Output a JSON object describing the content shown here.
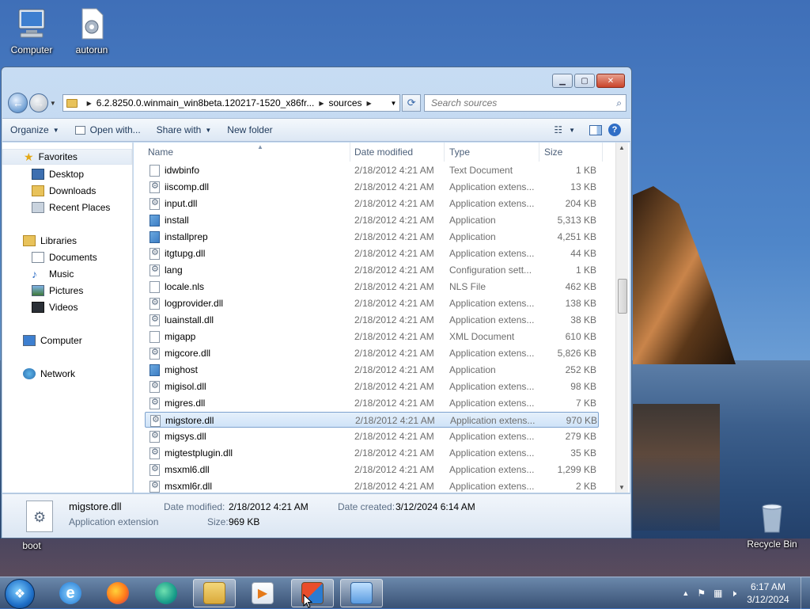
{
  "desktop": {
    "icons": [
      {
        "label": "Computer"
      },
      {
        "label": "autorun"
      },
      {
        "label": "boot"
      },
      {
        "label": "Recycle Bin"
      }
    ]
  },
  "window": {
    "address_segments": [
      "6.2.8250.0.winmain_win8beta.120217-1520_x86fr...",
      "sources"
    ],
    "search_placeholder": "Search sources",
    "toolbar": {
      "organize": "Organize",
      "open_with": "Open with...",
      "share_with": "Share with",
      "new_folder": "New folder"
    },
    "nav_pane": {
      "favorites": "Favorites",
      "desktop": "Desktop",
      "downloads": "Downloads",
      "recent_places": "Recent Places",
      "libraries": "Libraries",
      "documents": "Documents",
      "music": "Music",
      "pictures": "Pictures",
      "videos": "Videos",
      "computer": "Computer",
      "network": "Network"
    },
    "columns": {
      "name": "Name",
      "date": "Date modified",
      "type": "Type",
      "size": "Size"
    },
    "files": [
      {
        "name": "idwbinfo",
        "date": "2/18/2012 4:21 AM",
        "type": "Text Document",
        "size": "1 KB",
        "icon": "text"
      },
      {
        "name": "iiscomp.dll",
        "date": "2/18/2012 4:21 AM",
        "type": "Application extens...",
        "size": "13 KB",
        "icon": "dll"
      },
      {
        "name": "input.dll",
        "date": "2/18/2012 4:21 AM",
        "type": "Application extens...",
        "size": "204 KB",
        "icon": "dll"
      },
      {
        "name": "install",
        "date": "2/18/2012 4:21 AM",
        "type": "Application",
        "size": "5,313 KB",
        "icon": "app"
      },
      {
        "name": "installprep",
        "date": "2/18/2012 4:21 AM",
        "type": "Application",
        "size": "4,251 KB",
        "icon": "app"
      },
      {
        "name": "itgtupg.dll",
        "date": "2/18/2012 4:21 AM",
        "type": "Application extens...",
        "size": "44 KB",
        "icon": "dll"
      },
      {
        "name": "lang",
        "date": "2/18/2012 4:21 AM",
        "type": "Configuration sett...",
        "size": "1 KB",
        "icon": "config"
      },
      {
        "name": "locale.nls",
        "date": "2/18/2012 4:21 AM",
        "type": "NLS File",
        "size": "462 KB",
        "icon": "text"
      },
      {
        "name": "logprovider.dll",
        "date": "2/18/2012 4:21 AM",
        "type": "Application extens...",
        "size": "138 KB",
        "icon": "dll"
      },
      {
        "name": "luainstall.dll",
        "date": "2/18/2012 4:21 AM",
        "type": "Application extens...",
        "size": "38 KB",
        "icon": "dll"
      },
      {
        "name": "migapp",
        "date": "2/18/2012 4:21 AM",
        "type": "XML Document",
        "size": "610 KB",
        "icon": "text"
      },
      {
        "name": "migcore.dll",
        "date": "2/18/2012 4:21 AM",
        "type": "Application extens...",
        "size": "5,826 KB",
        "icon": "dll"
      },
      {
        "name": "mighost",
        "date": "2/18/2012 4:21 AM",
        "type": "Application",
        "size": "252 KB",
        "icon": "app"
      },
      {
        "name": "migisol.dll",
        "date": "2/18/2012 4:21 AM",
        "type": "Application extens...",
        "size": "98 KB",
        "icon": "dll"
      },
      {
        "name": "migres.dll",
        "date": "2/18/2012 4:21 AM",
        "type": "Application extens...",
        "size": "7 KB",
        "icon": "dll"
      },
      {
        "name": "migstore.dll",
        "date": "2/18/2012 4:21 AM",
        "type": "Application extens...",
        "size": "970 KB",
        "icon": "dll",
        "selected": true
      },
      {
        "name": "migsys.dll",
        "date": "2/18/2012 4:21 AM",
        "type": "Application extens...",
        "size": "279 KB",
        "icon": "dll"
      },
      {
        "name": "migtestplugin.dll",
        "date": "2/18/2012 4:21 AM",
        "type": "Application extens...",
        "size": "35 KB",
        "icon": "dll"
      },
      {
        "name": "msxml6.dll",
        "date": "2/18/2012 4:21 AM",
        "type": "Application extens...",
        "size": "1,299 KB",
        "icon": "dll"
      },
      {
        "name": "msxml6r.dll",
        "date": "2/18/2012 4:21 AM",
        "type": "Application extens...",
        "size": "2 KB",
        "icon": "dll"
      }
    ],
    "details": {
      "name": "migstore.dll",
      "type": "Application extension",
      "modified_label": "Date modified:",
      "modified_value": "2/18/2012 4:21 AM",
      "created_label": "Date created:",
      "created_value": "3/12/2024 6:14 AM",
      "size_label": "Size:",
      "size_value": "969 KB"
    }
  },
  "taskbar": {
    "time": "6:17 AM",
    "date": "3/12/2024"
  },
  "colors": {
    "selection": "#cfe3f8",
    "accent": "#2f6ec6",
    "close": "#c9442a"
  }
}
